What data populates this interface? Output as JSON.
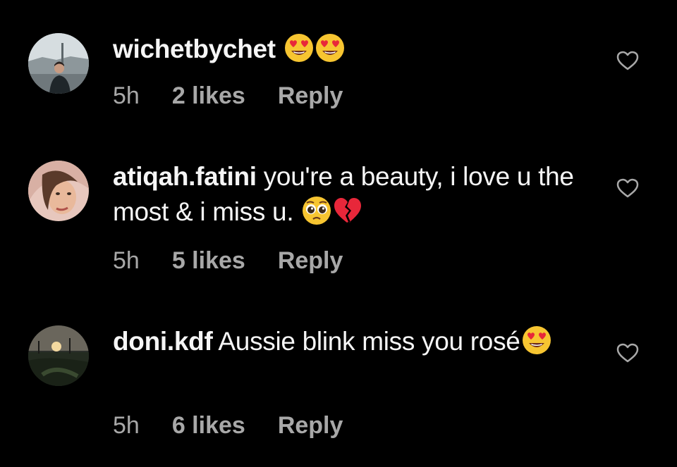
{
  "comments": [
    {
      "username": "wichetbychet",
      "text": "",
      "emojis": [
        "heart-eyes",
        "heart-eyes"
      ],
      "time": "5h",
      "likes": "2 likes",
      "reply": "Reply"
    },
    {
      "username": "atiqah.fatini",
      "text": "you're a beauty, i love u the most & i miss u.",
      "emojis": [
        "pleading-face",
        "broken-heart"
      ],
      "time": "5h",
      "likes": "5 likes",
      "reply": "Reply"
    },
    {
      "username": "doni.kdf",
      "text": "Aussie blink miss you rosé",
      "emojis": [
        "heart-eyes"
      ],
      "time": "5h",
      "likes": "6 likes",
      "reply": "Reply"
    }
  ],
  "colors": {
    "background": "#000000",
    "text": "#f5f5f5",
    "meta": "#a8a8a8"
  },
  "icons": {
    "like": "heart-outline-icon"
  }
}
